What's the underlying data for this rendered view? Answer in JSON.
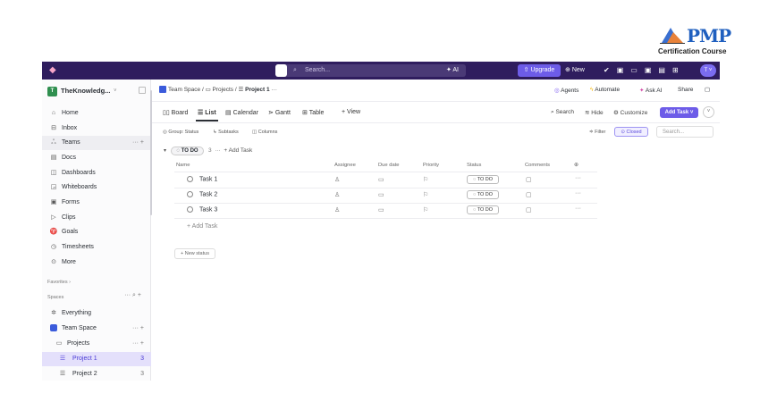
{
  "logo": {
    "text": "PMP",
    "subtitle": "Certification Course"
  },
  "topbar": {
    "search_placeholder": "Search...",
    "ai_label": "AI",
    "upgrade_label": "Upgrade",
    "new_label": "New",
    "avatar_initial": "T"
  },
  "workspace": {
    "name": "TheKnowledg...",
    "initial": "T"
  },
  "sidebar": {
    "items": [
      {
        "label": "Home",
        "icon": "home-icon"
      },
      {
        "label": "Inbox",
        "icon": "inbox-icon"
      },
      {
        "label": "Teams",
        "icon": "teams-icon"
      },
      {
        "label": "Docs",
        "icon": "docs-icon"
      },
      {
        "label": "Dashboards",
        "icon": "dashboards-icon"
      },
      {
        "label": "Whiteboards",
        "icon": "whiteboards-icon"
      },
      {
        "label": "Forms",
        "icon": "forms-icon"
      },
      {
        "label": "Clips",
        "icon": "clips-icon"
      },
      {
        "label": "Goals",
        "icon": "goals-icon"
      },
      {
        "label": "Timesheets",
        "icon": "timesheets-icon"
      },
      {
        "label": "More",
        "icon": "more-icon"
      }
    ],
    "favorites_label": "Favorites",
    "spaces_label": "Spaces",
    "everything_label": "Everything",
    "team_space_label": "Team Space",
    "projects_label": "Projects",
    "project1_label": "Project 1",
    "project1_count": "3",
    "project2_label": "Project 2",
    "project2_count": "3"
  },
  "breadcrumb": {
    "space": "Team Space",
    "sep1": "/",
    "folder": "Projects",
    "sep2": "/",
    "list": "Project 1",
    "more": "···"
  },
  "header_actions": {
    "agents": "Agents",
    "automate": "Automate",
    "ask_ai": "Ask AI",
    "share": "Share"
  },
  "views": {
    "board": "Board",
    "list": "List",
    "calendar": "Calendar",
    "gantt": "Gantt",
    "table": "Table",
    "add_view": "+ View"
  },
  "toolbar": {
    "search": "Search",
    "hide": "Hide",
    "customize": "Customize",
    "add_task": "Add Task"
  },
  "filters": {
    "group": "Group: Status",
    "subtasks": "Subtasks",
    "columns": "Columns",
    "filter": "Filter",
    "closed": "Closed",
    "search_placeholder": "Search..."
  },
  "group": {
    "status": "TO DO",
    "count": "3",
    "more": "···",
    "add_task": "+ Add Task"
  },
  "columns": {
    "name": "Name",
    "assignee": "Assignee",
    "due_date": "Due date",
    "priority": "Priority",
    "status": "Status",
    "comments": "Comments"
  },
  "tasks": [
    {
      "name": "Task 1",
      "status": "TO DO"
    },
    {
      "name": "Task 2",
      "status": "TO DO"
    },
    {
      "name": "Task 3",
      "status": "TO DO"
    }
  ],
  "add_task_row": "+ Add Task",
  "new_status": "+ New status"
}
